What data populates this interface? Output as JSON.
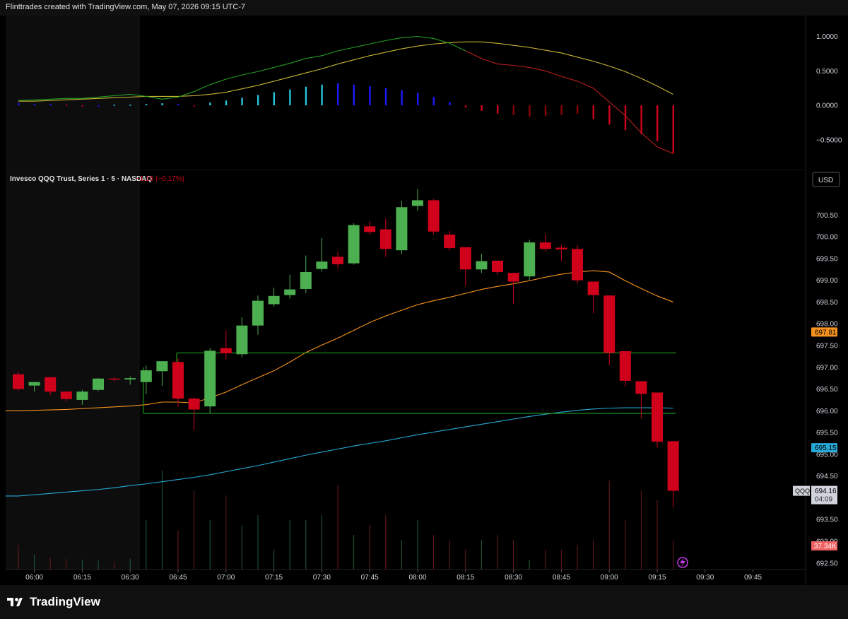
{
  "header": {
    "attribution": "Flinttrades created with TradingView.com, May 07, 2026 09:15 UTC-7"
  },
  "footer": {
    "brand": "TradingView"
  },
  "symbol_bar": {
    "title": "Invesco QQQ Trust, Series 1 · 5 · NASDAQ",
    "change": "−1.15 (−0.17%)",
    "currency": "USD"
  },
  "colors": {
    "up": "#4caf50",
    "down": "#d0021b",
    "ma_orange": "#f7931e",
    "ma_blue": "#26a9d6",
    "box": "#22b522",
    "osc_green": "#22a022",
    "osc_red": "#b71c1c",
    "osc_yellow": "#c8b432"
  },
  "price_badges": [
    {
      "label": "697.81",
      "value": 697.81,
      "bg": "#f7931e",
      "fg": "#000000"
    },
    {
      "label": "695.15",
      "value": 695.15,
      "bg": "#26a9d6",
      "fg": "#000000"
    }
  ],
  "last_price": {
    "symbol": "QQQ",
    "price": "694.16",
    "countdown": "04:09",
    "value": 694.16
  },
  "volume_badge": "37.34K",
  "icons": {
    "replay": "lightning-icon",
    "logo": "tradingview-logo-icon"
  },
  "chart_data": {
    "type": "candlestick",
    "title": "Invesco QQQ Trust, Series 1 · 5 · NASDAQ",
    "x_ticks": [
      "06:00",
      "06:15",
      "06:30",
      "06:45",
      "07:00",
      "07:15",
      "07:30",
      "07:45",
      "08:00",
      "08:15",
      "08:30",
      "08:45",
      "09:00",
      "09:15",
      "09:30",
      "09:45"
    ],
    "price_ticks": [
      "700.50",
      "700.00",
      "699.50",
      "699.00",
      "698.50",
      "698.00",
      "697.50",
      "697.00",
      "696.50",
      "696.00",
      "695.50",
      "695.00",
      "694.50",
      "693.50",
      "693.00",
      "692.50"
    ],
    "price_range": [
      692.35,
      701.35
    ],
    "osc_ticks": [
      "1.0000",
      "0.5000",
      "0.0000",
      "−0.5000"
    ],
    "osc_range": [
      -0.85,
      1.2
    ],
    "candles": [
      {
        "t": "05:55",
        "o": 696.84,
        "h": 696.9,
        "l": 696.46,
        "c": 696.5
      },
      {
        "t": "06:00",
        "o": 696.58,
        "h": 696.64,
        "l": 696.44,
        "c": 696.66
      },
      {
        "t": "06:05",
        "o": 696.77,
        "h": 696.78,
        "l": 696.36,
        "c": 696.44
      },
      {
        "t": "06:10",
        "o": 696.44,
        "h": 696.45,
        "l": 696.22,
        "c": 696.27
      },
      {
        "t": "06:15",
        "o": 696.25,
        "h": 696.48,
        "l": 696.14,
        "c": 696.44
      },
      {
        "t": "06:20",
        "o": 696.48,
        "h": 696.75,
        "l": 696.45,
        "c": 696.74
      },
      {
        "t": "06:25",
        "o": 696.74,
        "h": 696.77,
        "l": 696.68,
        "c": 696.72
      },
      {
        "t": "06:30",
        "o": 696.72,
        "h": 696.79,
        "l": 696.6,
        "c": 696.75
      },
      {
        "t": "06:35",
        "o": 696.66,
        "h": 697.04,
        "l": 696.38,
        "c": 696.93
      },
      {
        "t": "06:40",
        "o": 696.91,
        "h": 697.12,
        "l": 696.57,
        "c": 697.14
      },
      {
        "t": "06:45",
        "o": 697.12,
        "h": 697.2,
        "l": 696.09,
        "c": 696.28
      },
      {
        "t": "06:50",
        "o": 696.28,
        "h": 696.31,
        "l": 695.55,
        "c": 696.03
      },
      {
        "t": "06:55",
        "o": 696.1,
        "h": 697.44,
        "l": 695.95,
        "c": 697.38
      },
      {
        "t": "07:00",
        "o": 697.44,
        "h": 697.84,
        "l": 697.18,
        "c": 697.32
      },
      {
        "t": "07:05",
        "o": 697.3,
        "h": 698.15,
        "l": 697.22,
        "c": 697.96
      },
      {
        "t": "07:10",
        "o": 697.96,
        "h": 698.65,
        "l": 697.75,
        "c": 698.53
      },
      {
        "t": "07:15",
        "o": 698.45,
        "h": 698.83,
        "l": 698.4,
        "c": 698.64
      },
      {
        "t": "07:20",
        "o": 698.66,
        "h": 699.13,
        "l": 698.58,
        "c": 698.79
      },
      {
        "t": "07:25",
        "o": 698.8,
        "h": 699.57,
        "l": 698.71,
        "c": 699.19
      },
      {
        "t": "07:30",
        "o": 699.26,
        "h": 699.97,
        "l": 699.2,
        "c": 699.43
      },
      {
        "t": "07:35",
        "o": 699.54,
        "h": 699.65,
        "l": 699.27,
        "c": 699.37
      },
      {
        "t": "07:40",
        "o": 699.39,
        "h": 700.31,
        "l": 699.36,
        "c": 700.27
      },
      {
        "t": "07:45",
        "o": 700.24,
        "h": 700.36,
        "l": 700.04,
        "c": 700.11
      },
      {
        "t": "07:50",
        "o": 700.17,
        "h": 700.42,
        "l": 699.54,
        "c": 699.72
      },
      {
        "t": "07:55",
        "o": 699.69,
        "h": 700.83,
        "l": 699.6,
        "c": 700.68
      },
      {
        "t": "08:00",
        "o": 700.71,
        "h": 701.1,
        "l": 700.6,
        "c": 700.84
      },
      {
        "t": "08:05",
        "o": 700.84,
        "h": 700.87,
        "l": 700.06,
        "c": 700.12
      },
      {
        "t": "08:10",
        "o": 700.05,
        "h": 700.13,
        "l": 699.69,
        "c": 699.74
      },
      {
        "t": "08:15",
        "o": 699.76,
        "h": 699.73,
        "l": 698.87,
        "c": 699.25
      },
      {
        "t": "08:20",
        "o": 699.25,
        "h": 699.61,
        "l": 699.17,
        "c": 699.44
      },
      {
        "t": "08:25",
        "o": 699.45,
        "h": 699.42,
        "l": 699.12,
        "c": 699.19
      },
      {
        "t": "08:30",
        "o": 699.17,
        "h": 699.17,
        "l": 698.45,
        "c": 698.97
      },
      {
        "t": "08:35",
        "o": 699.09,
        "h": 699.93,
        "l": 699.0,
        "c": 699.87
      },
      {
        "t": "08:40",
        "o": 699.87,
        "h": 700.06,
        "l": 699.66,
        "c": 699.72
      },
      {
        "t": "08:45",
        "o": 699.75,
        "h": 699.82,
        "l": 699.45,
        "c": 699.71
      },
      {
        "t": "08:50",
        "o": 699.72,
        "h": 699.81,
        "l": 698.92,
        "c": 699.0
      },
      {
        "t": "08:55",
        "o": 698.97,
        "h": 698.94,
        "l": 698.24,
        "c": 698.66
      },
      {
        "t": "09:00",
        "o": 698.65,
        "h": 698.66,
        "l": 697.05,
        "c": 697.33
      },
      {
        "t": "09:05",
        "o": 697.37,
        "h": 697.36,
        "l": 696.55,
        "c": 696.69
      },
      {
        "t": "09:10",
        "o": 696.68,
        "h": 696.68,
        "l": 695.82,
        "c": 696.39
      },
      {
        "t": "09:15",
        "o": 696.42,
        "h": 696.42,
        "l": 695.15,
        "c": 695.29
      },
      {
        "t": "09:20",
        "o": 695.3,
        "h": 695.27,
        "l": 693.78,
        "c": 694.16
      }
    ],
    "volume": [
      50,
      30,
      24,
      22,
      20,
      18,
      16,
      22,
      100,
      200,
      80,
      160,
      100,
      150,
      90,
      110,
      40,
      100,
      100,
      110,
      170,
      70,
      90,
      110,
      60,
      100,
      70,
      60,
      40,
      60,
      70,
      60,
      20,
      40,
      40,
      50,
      60,
      180,
      100,
      160,
      140,
      60
    ],
    "ma_orange": [
      696.0,
      696.01,
      696.02,
      696.03,
      696.05,
      696.07,
      696.09,
      696.11,
      696.14,
      696.2,
      696.2,
      696.18,
      696.3,
      696.43,
      696.6,
      696.76,
      696.92,
      697.12,
      697.34,
      697.51,
      697.67,
      697.85,
      698.03,
      698.18,
      698.31,
      698.44,
      698.53,
      698.61,
      698.7,
      698.79,
      698.86,
      698.92,
      698.99,
      699.07,
      699.14,
      699.19,
      699.22,
      699.19,
      698.99,
      698.81,
      698.64,
      698.5
    ],
    "ma_blue": [
      694.04,
      694.07,
      694.1,
      694.13,
      694.16,
      694.19,
      694.23,
      694.28,
      694.32,
      694.37,
      694.42,
      694.47,
      694.53,
      694.6,
      694.67,
      694.74,
      694.82,
      694.9,
      694.98,
      695.05,
      695.12,
      695.19,
      695.25,
      695.31,
      695.38,
      695.45,
      695.51,
      695.57,
      695.63,
      695.69,
      695.75,
      695.81,
      695.87,
      695.92,
      695.97,
      696.01,
      696.04,
      696.06,
      696.07,
      696.07,
      696.07,
      696.06
    ],
    "box_upper": {
      "price": 697.33,
      "from": "06:45",
      "to": "09:20"
    },
    "box_lower": {
      "price": 695.94,
      "from": "06:35",
      "to": "09:20"
    },
    "osc_hist": [
      0.03,
      0.02,
      0.02,
      0.01,
      0.0,
      0.0,
      0.01,
      0.01,
      0.02,
      0.03,
      0.02,
      0.0,
      0.04,
      0.07,
      0.11,
      0.15,
      0.19,
      0.23,
      0.27,
      0.3,
      0.32,
      0.3,
      0.28,
      0.25,
      0.22,
      0.18,
      0.12,
      0.05,
      -0.03,
      -0.08,
      -0.12,
      -0.14,
      -0.16,
      -0.15,
      -0.14,
      -0.12,
      -0.2,
      -0.28,
      -0.36,
      -0.42,
      -0.52,
      -0.7
    ],
    "osc_hist_colors": [
      "#1a1aff",
      "#1a1aff",
      "#1a1aff",
      "#d0021b",
      "#d0021b",
      "#1a1aff",
      "#26c6da",
      "#26c6da",
      "#26c6da",
      "#26c6da",
      "#1a1aff",
      "#d0021b",
      "#26c6da",
      "#26c6da",
      "#26c6da",
      "#26c6da",
      "#26c6da",
      "#26c6da",
      "#26c6da",
      "#26c6da",
      "#1a1aff",
      "#1a1aff",
      "#1a1aff",
      "#1a1aff",
      "#1a1aff",
      "#1a1aff",
      "#1a1aff",
      "#1a1aff",
      "#d0021b",
      "#d0021b",
      "#d0021b",
      "#8b0000",
      "#8b0000",
      "#8b0000",
      "#8b0000",
      "#8b0000",
      "#d0021b",
      "#d0021b",
      "#d0021b",
      "#d0021b",
      "#d0021b",
      "#d0021b"
    ],
    "osc_line1": [
      0.07,
      0.08,
      0.09,
      0.1,
      0.1,
      0.12,
      0.14,
      0.16,
      0.13,
      0.09,
      0.12,
      0.2,
      0.3,
      0.38,
      0.44,
      0.49,
      0.55,
      0.61,
      0.68,
      0.72,
      0.79,
      0.84,
      0.89,
      0.94,
      0.98,
      1.0,
      0.97,
      0.9,
      0.79,
      0.68,
      0.6,
      0.58,
      0.55,
      0.5,
      0.42,
      0.35,
      0.25,
      0.05,
      -0.15,
      -0.4,
      -0.6,
      -0.7
    ],
    "osc_line2": [
      0.06,
      0.06,
      0.07,
      0.08,
      0.09,
      0.1,
      0.11,
      0.12,
      0.13,
      0.13,
      0.13,
      0.14,
      0.16,
      0.19,
      0.24,
      0.29,
      0.35,
      0.41,
      0.47,
      0.53,
      0.6,
      0.66,
      0.72,
      0.77,
      0.82,
      0.86,
      0.89,
      0.91,
      0.92,
      0.92,
      0.9,
      0.87,
      0.84,
      0.8,
      0.76,
      0.7,
      0.64,
      0.57,
      0.49,
      0.39,
      0.28,
      0.16
    ]
  }
}
